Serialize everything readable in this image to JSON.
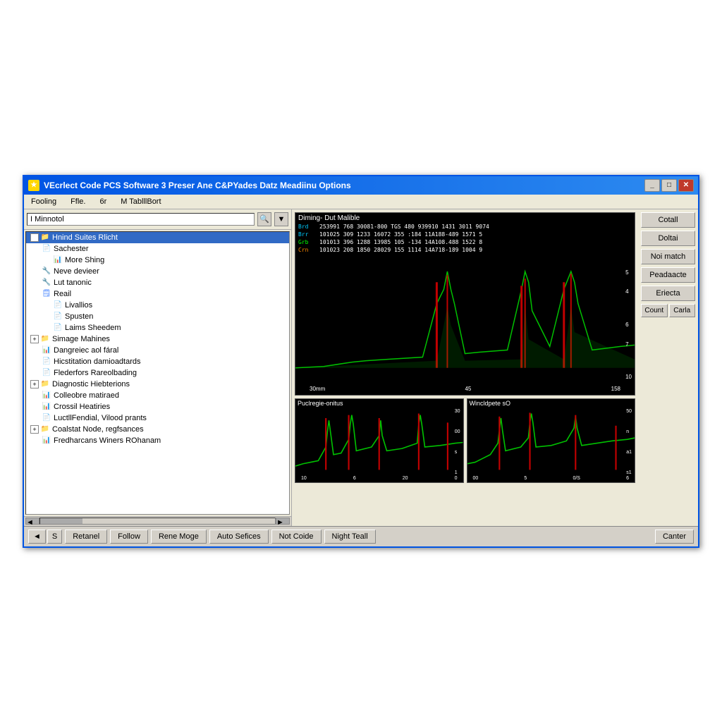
{
  "window": {
    "title": "VEcrlect Code PCS Software 3 Preser Ane C&PYades Datz Meadiinu Options",
    "icon": "★"
  },
  "menu": {
    "items": [
      "Fooling",
      "Ffle.",
      "6r",
      "M TablllBort"
    ]
  },
  "search": {
    "placeholder": "I Minnotol",
    "value": "I Minnotol"
  },
  "tree": {
    "nodes": [
      {
        "id": 1,
        "label": "Hnind Suites Rlicht",
        "level": 0,
        "type": "folder",
        "expanded": true,
        "selected": true
      },
      {
        "id": 2,
        "label": "Sachester",
        "level": 1,
        "type": "page"
      },
      {
        "id": 3,
        "label": "More Shing",
        "level": 2,
        "type": "chart"
      },
      {
        "id": 4,
        "label": "Neve devieer",
        "level": 1,
        "type": "tool"
      },
      {
        "id": 5,
        "label": "Lut tanonic",
        "level": 1,
        "type": "tool"
      },
      {
        "id": 6,
        "label": "Reail",
        "level": 1,
        "type": "page"
      },
      {
        "id": 7,
        "label": "Livallios",
        "level": 2,
        "type": "page"
      },
      {
        "id": 8,
        "label": "Spusten",
        "level": 2,
        "type": "page"
      },
      {
        "id": 9,
        "label": "Laims Sheedem",
        "level": 2,
        "type": "page"
      },
      {
        "id": 10,
        "label": "Simage Mahines",
        "level": 1,
        "type": "folder",
        "expandable": true
      },
      {
        "id": 11,
        "label": "Dangreiec aol fáral",
        "level": 2,
        "type": "chart"
      },
      {
        "id": 12,
        "label": "Hicstitation damioadtards",
        "level": 2,
        "type": "page"
      },
      {
        "id": 13,
        "label": "Flederfors Rareolbading",
        "level": 2,
        "type": "page"
      },
      {
        "id": 14,
        "label": "Diagnostic Hiebterions",
        "level": 1,
        "type": "folder",
        "expandable": true
      },
      {
        "id": 15,
        "label": "Colleobre matiraed",
        "level": 2,
        "type": "chart"
      },
      {
        "id": 16,
        "label": "Crossil Heatiries",
        "level": 2,
        "type": "chart"
      },
      {
        "id": 17,
        "label": "LuctllFendial, Vilood prants",
        "level": 2,
        "type": "page"
      },
      {
        "id": 18,
        "label": "Coalstat Node, regfsances",
        "level": 1,
        "type": "folder",
        "expandable": true
      },
      {
        "id": 19,
        "label": "Fredharcans Winers ROhanam",
        "level": 1,
        "type": "chart"
      }
    ]
  },
  "main_chart": {
    "title": "Diming- Dut Malible",
    "x_labels": [
      "30mm",
      "45",
      "158"
    ],
    "y_labels": [
      "5",
      "4",
      "",
      "6",
      "7",
      "",
      "10"
    ],
    "data_rows": [
      {
        "label": "Brd",
        "values": "253991  768  30081-800  TGS  480 939910 1431 3011  9074"
      },
      {
        "label": "Brr",
        "values": "101025  309  1233 16072  355  :184 11A188-489 1571   5"
      },
      {
        "label": "Grb",
        "values": "101013  396  1288 13985  105  -134 14A108.488 1522   8"
      },
      {
        "label": "Crn",
        "values": "101023  208  1850 28029  155  1114 14A718-189 1004   9"
      }
    ]
  },
  "sub_charts": [
    {
      "title": "Puclregie-onitus"
    },
    {
      "title": "Wincldpete sO"
    }
  ],
  "side_buttons": {
    "buttons": [
      "Cotall",
      "Doltai",
      "Noi match",
      "Peadaacte",
      "Eriecta"
    ],
    "small_buttons": [
      "Count",
      "Carla"
    ]
  },
  "bottom_toolbar": {
    "nav_prev": "◄",
    "nav_next": "S",
    "buttons": [
      "Retanel",
      "Follow",
      "Rene Moge",
      "Auto Sefices",
      "Not Coide",
      "Night Teall"
    ],
    "cancel": "Canter"
  },
  "colors": {
    "accent": "#0054e3",
    "chart_green": "#00c000",
    "chart_red": "#c00000",
    "chart_bg": "#000000",
    "window_bg": "#ece9d8",
    "button_bg": "#d4d0c8"
  }
}
